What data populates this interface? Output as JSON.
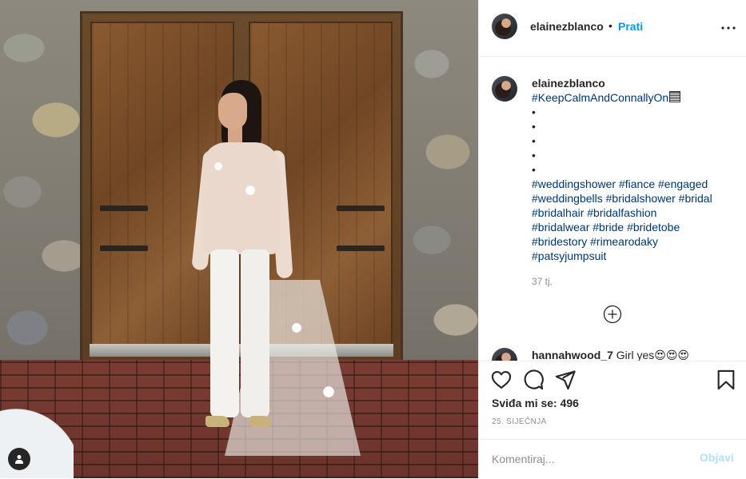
{
  "post": {
    "username": "elainezblanco",
    "follow_separator": "•",
    "follow_label": "Prati",
    "caption": {
      "username": "elainezblanco",
      "first_tag": "#KeepCalmAndConnallyOn",
      "bullet": "•",
      "tag_lines": [
        "#weddingshower #fiance #engaged",
        "#weddingbells #bridalshower #bridal",
        "#bridalhair #bridalfashion",
        "#bridalwear #bride #bridetobe",
        "#bridestory #rimearodaky",
        "#patsyjumpsuit"
      ],
      "time": "37 tj."
    },
    "comment": {
      "username": "hannahwood_7",
      "text": "Girl yes😍😍😍"
    },
    "likes_text": "Sviđa mi se: 496",
    "date": "25. SIJEČNJA",
    "comment_placeholder": "Komentiraj...",
    "post_label": "Objavi"
  },
  "icons": {
    "more": "more-options-icon",
    "load_more": "plus-circle-icon",
    "like": "heart-icon",
    "comment": "comment-icon",
    "share": "paper-plane-icon",
    "save": "bookmark-icon",
    "user_tags": "user-tag-icon"
  },
  "colors": {
    "accent": "#0095f6",
    "post_disabled": "#b2dffc",
    "text": "#262626",
    "muted": "#8e8e8e",
    "hashtag": "#00376b"
  }
}
